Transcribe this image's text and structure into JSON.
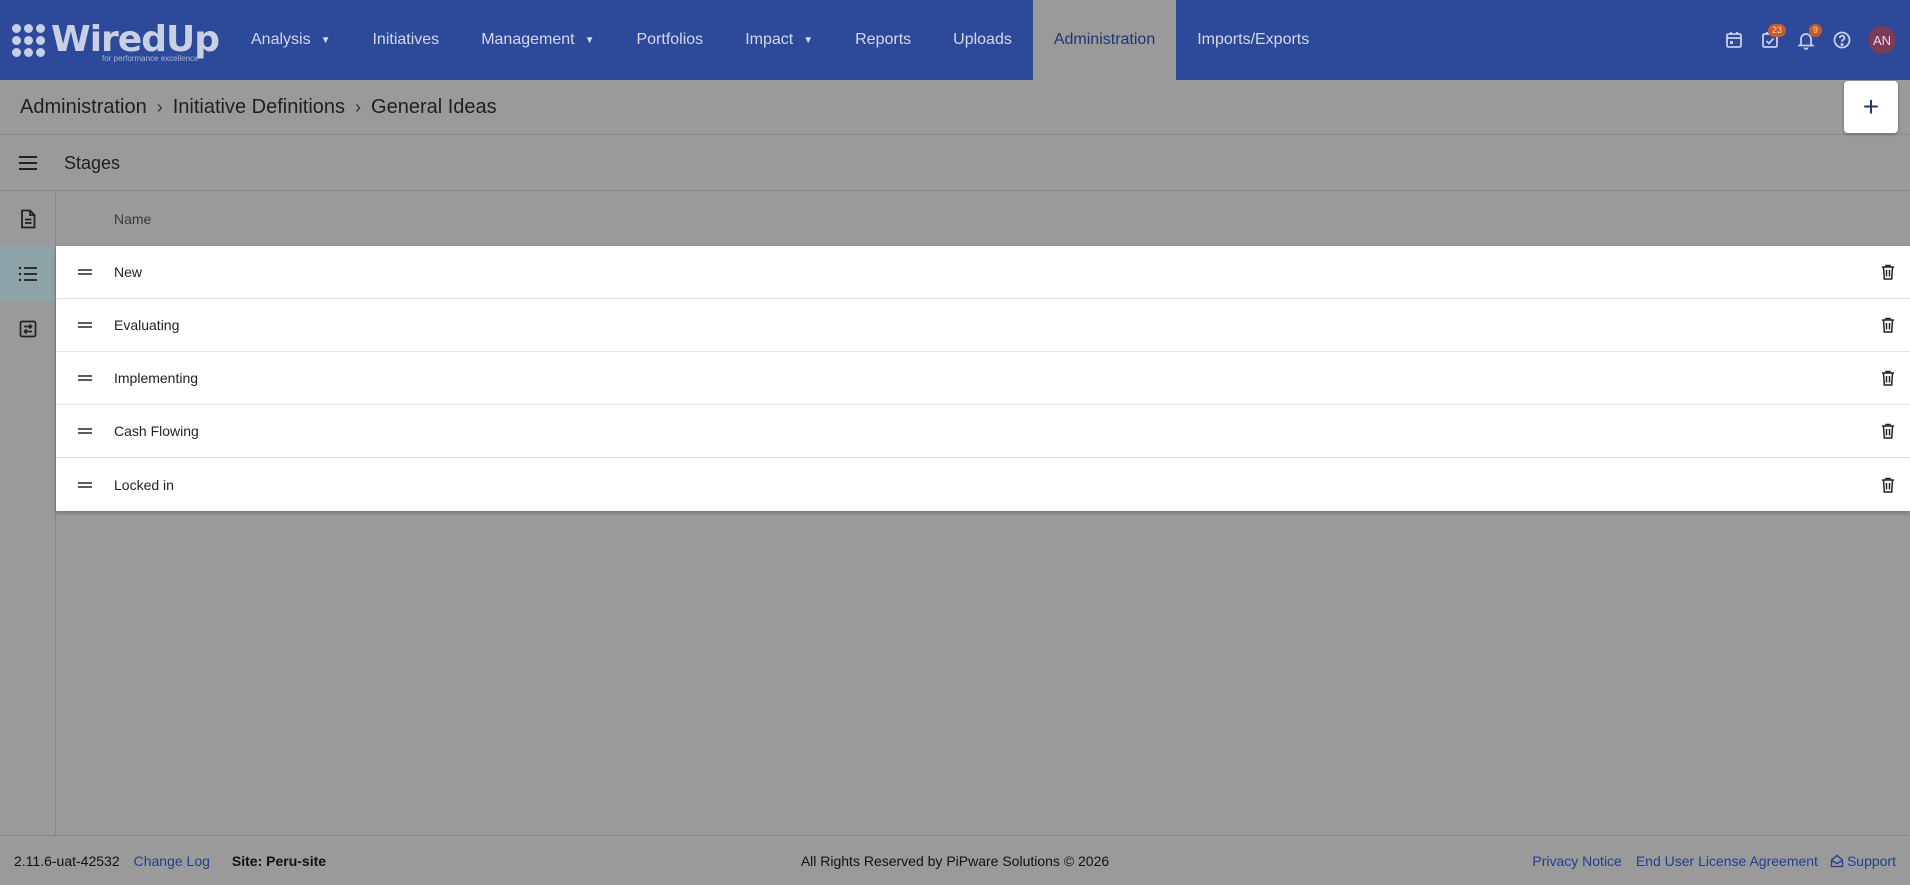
{
  "app": {
    "logo_text": "WiredUp",
    "logo_tagline": "for performance excellence"
  },
  "nav": {
    "items": [
      {
        "label": "Analysis",
        "has_dropdown": true
      },
      {
        "label": "Initiatives",
        "has_dropdown": false
      },
      {
        "label": "Management",
        "has_dropdown": true
      },
      {
        "label": "Portfolios",
        "has_dropdown": false
      },
      {
        "label": "Impact",
        "has_dropdown": true
      },
      {
        "label": "Reports",
        "has_dropdown": false
      },
      {
        "label": "Uploads",
        "has_dropdown": false
      },
      {
        "label": "Administration",
        "has_dropdown": false,
        "active": true
      },
      {
        "label": "Imports/Exports",
        "has_dropdown": false
      }
    ],
    "tasks_badge": "23",
    "notifications_badge": "9",
    "avatar_initials": "AN"
  },
  "breadcrumb": {
    "items": [
      "Administration",
      "Initiative Definitions",
      "General Ideas"
    ],
    "add_label": "+"
  },
  "section": {
    "title": "Stages"
  },
  "table": {
    "column_name": "Name",
    "rows": [
      "New",
      "Evaluating",
      "Implementing",
      "Cash Flowing",
      "Locked in"
    ]
  },
  "footer": {
    "version": "2.11.6-uat-42532",
    "change_log": "Change Log",
    "site": "Site: Peru-site",
    "copyright": "All Rights Reserved by PiPware Solutions © 2026",
    "privacy": "Privacy Notice",
    "eula": "End User License Agreement",
    "support": "Support"
  },
  "colors": {
    "nav_bg": "#2d4a9a",
    "overlay_bg": "#9a9a9a",
    "link": "#203f8f",
    "badge": "#c85a2a",
    "avatar": "#7a3b59"
  }
}
